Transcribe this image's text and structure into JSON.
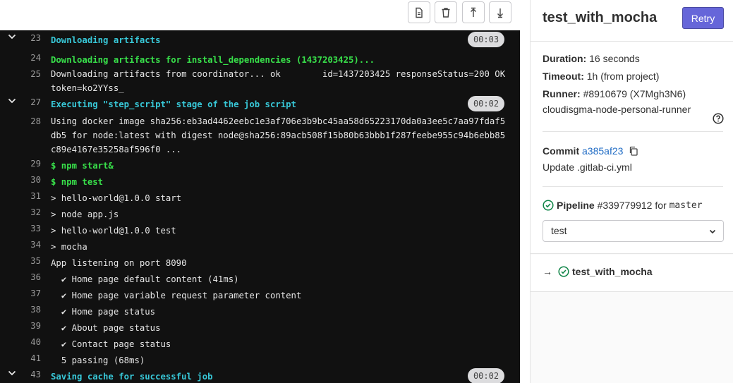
{
  "toolbar": {
    "buttons": [
      {
        "name": "show-raw",
        "icon": "document-icon"
      },
      {
        "name": "erase-log",
        "icon": "trash-icon"
      },
      {
        "name": "scroll-top",
        "icon": "scroll-up-icon"
      },
      {
        "name": "scroll-bottom",
        "icon": "scroll-down-icon"
      }
    ]
  },
  "log": {
    "lines": [
      {
        "num": "23",
        "text": "Downloading artifacts",
        "style": "section",
        "collapsible": true,
        "duration": "00:03"
      },
      {
        "num": "24",
        "text": "Downloading artifacts for install_dependencies (1437203425)...",
        "style": "green"
      },
      {
        "num": "25",
        "text": "Downloading artifacts from coordinator... ok        id=1437203425 responseStatus=200 OK token=ko2YYss_",
        "style": "plain"
      },
      {
        "num": "27",
        "text": "Executing \"step_script\" stage of the job script",
        "style": "section",
        "collapsible": true,
        "duration": "00:02"
      },
      {
        "num": "28",
        "text": "Using docker image sha256:eb3ad4462eebc1e3af706e3b9bc45aa58d65223170da0a3ee5c7aa97fdaf5db5 for node:latest with digest node@sha256:89acb508f15b80b63bbb1f287feebe955c94b6ebb85c89e4167e35258af596f0 ...",
        "style": "plain"
      },
      {
        "num": "29",
        "text": "$ npm start&",
        "style": "green"
      },
      {
        "num": "30",
        "text": "$ npm test",
        "style": "green"
      },
      {
        "num": "31",
        "text": "> hello-world@1.0.0 start",
        "style": "plain"
      },
      {
        "num": "32",
        "text": "> node app.js",
        "style": "plain"
      },
      {
        "num": "33",
        "text": "> hello-world@1.0.0 test",
        "style": "plain"
      },
      {
        "num": "34",
        "text": "> mocha",
        "style": "plain"
      },
      {
        "num": "35",
        "text": "App listening on port 8090",
        "style": "plain"
      },
      {
        "num": "36",
        "text": "  ✔ Home page default content (41ms)",
        "style": "plain"
      },
      {
        "num": "37",
        "text": "  ✔ Home page variable request parameter content",
        "style": "plain"
      },
      {
        "num": "38",
        "text": "  ✔ Home page status",
        "style": "plain"
      },
      {
        "num": "39",
        "text": "  ✔ About page status",
        "style": "plain"
      },
      {
        "num": "40",
        "text": "  ✔ Contact page status",
        "style": "plain"
      },
      {
        "num": "41",
        "text": "  5 passing (68ms)",
        "style": "plain"
      },
      {
        "num": "43",
        "text": "Saving cache for successful job",
        "style": "section",
        "collapsible": true,
        "duration": "00:02"
      }
    ]
  },
  "sidebar": {
    "job_title": "test_with_mocha",
    "retry_label": "Retry",
    "duration_label": "Duration:",
    "duration_value": "16 seconds",
    "timeout_label": "Timeout:",
    "timeout_value": "1h (from project)",
    "runner_label": "Runner:",
    "runner_value": "#8910679 (X7Mgh3N6)",
    "runner_name": "cloudisgma-node-personal-runner",
    "commit_label": "Commit",
    "commit_sha": "a385af23",
    "commit_message": "Update .gitlab-ci.yml",
    "pipeline_label": "Pipeline",
    "pipeline_id": "#339779912",
    "pipeline_for": "for",
    "pipeline_branch": "master",
    "stage_selected": "test",
    "job_arrow": "→",
    "job_item": "test_with_mocha"
  },
  "colors": {
    "log_bg": "#111111",
    "section_cyan": "#38c8d8",
    "command_green": "#38e04a",
    "retry_bg": "#6666d9",
    "link_blue": "#1f6bc4",
    "success_green": "#108548"
  }
}
